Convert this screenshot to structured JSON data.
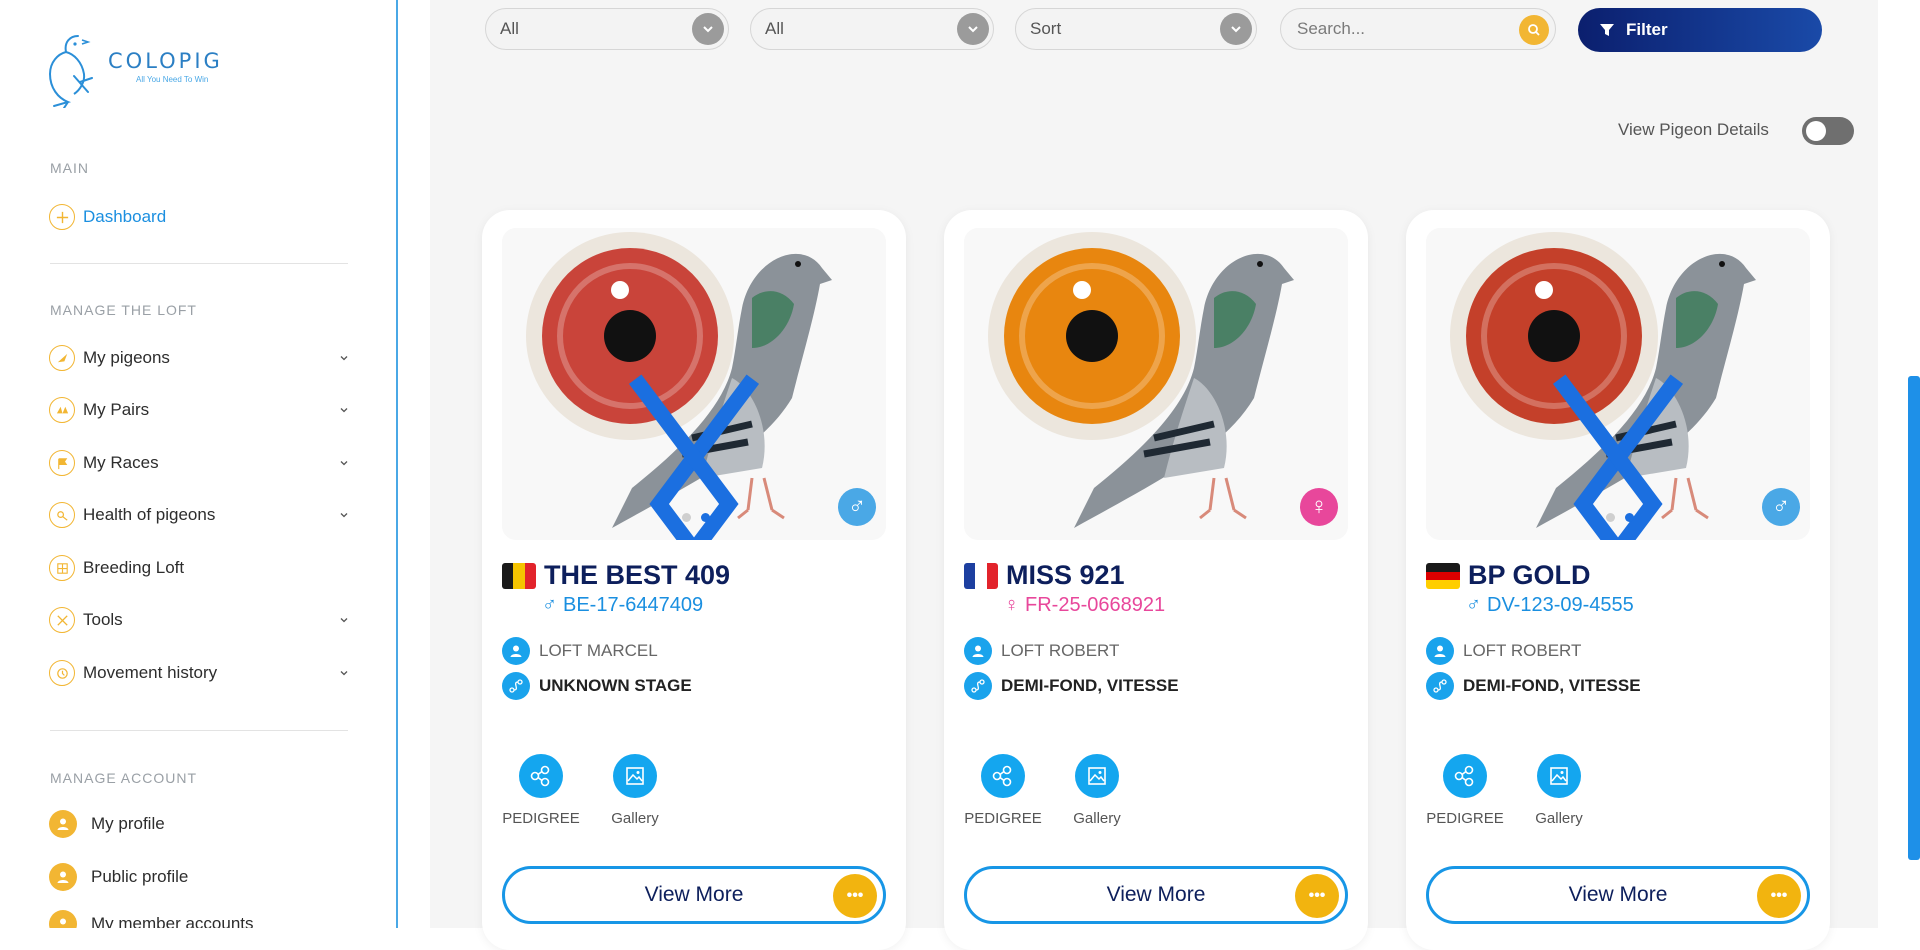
{
  "brand": {
    "name": "COLOPIG",
    "tagline": "All You Need To Win"
  },
  "sidebar": {
    "main_title": "MAIN",
    "dashboard": "Dashboard",
    "manage_loft_title": "MANAGE THE LOFT",
    "loft_items": [
      {
        "label": "My pigeons",
        "icon": "pigeon-icon",
        "has_submenu": true
      },
      {
        "label": "My Pairs",
        "icon": "pair-icon",
        "has_submenu": true
      },
      {
        "label": "My Races",
        "icon": "flag-icon",
        "has_submenu": true
      },
      {
        "label": "Health of pigeons",
        "icon": "health-icon",
        "has_submenu": true
      },
      {
        "label": "Breeding Loft",
        "icon": "breeding-icon",
        "has_submenu": false
      },
      {
        "label": "Tools",
        "icon": "tools-icon",
        "has_submenu": true
      },
      {
        "label": "Movement history",
        "icon": "history-icon",
        "has_submenu": true
      }
    ],
    "manage_account_title": "MANAGE ACCOUNT",
    "account_items": [
      {
        "label": "My profile",
        "icon": "user-icon"
      },
      {
        "label": "Public profile",
        "icon": "user-icon"
      },
      {
        "label": "My member accounts",
        "icon": "users-icon"
      }
    ]
  },
  "filters": {
    "select1": "All",
    "select2": "All",
    "sort": "Sort",
    "search_placeholder": "Search...",
    "filter_button": "Filter"
  },
  "toggle": {
    "label": "View Pigeon Details",
    "on": false
  },
  "cards": [
    {
      "name": "THE BEST 409",
      "ring": "BE-17-6447409",
      "sex": "male",
      "sex_symbol": "♂",
      "country": "Belgium",
      "loft": "LOFT MARCEL",
      "stage": "UNKNOWN STAGE",
      "pedigree": "PEDIGREE",
      "gallery": "Gallery",
      "view_more": "View More",
      "eye_color": "#c9443a"
    },
    {
      "name": "MISS 921",
      "ring": "FR-25-0668921",
      "sex": "female",
      "sex_symbol": "♀",
      "country": "France",
      "loft": "LOFT ROBERT",
      "stage": "DEMI-FOND, VITESSE",
      "pedigree": "PEDIGREE",
      "gallery": "Gallery",
      "view_more": "View More",
      "eye_color": "#e8860f"
    },
    {
      "name": "BP GOLD",
      "ring": "DV-123-09-4555",
      "sex": "male",
      "sex_symbol": "♂",
      "country": "Germany",
      "loft": "LOFT ROBERT",
      "stage": "DEMI-FOND, VITESSE",
      "pedigree": "PEDIGREE",
      "gallery": "Gallery",
      "view_more": "View More",
      "eye_color": "#c4402a"
    }
  ],
  "colors": {
    "accent_blue": "#1aa3ec",
    "gold": "#f2b633",
    "navy": "#0d1f5c",
    "male": "#4aa8e6",
    "female": "#e8479b"
  }
}
